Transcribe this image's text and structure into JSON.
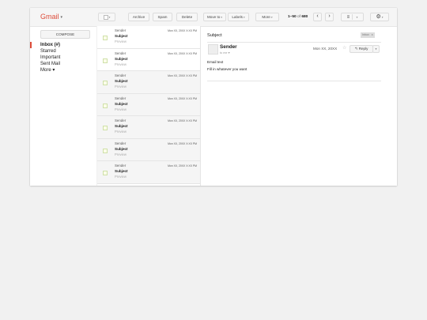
{
  "app": {
    "logo": "Gmail",
    "logo_caret": "▾"
  },
  "toolbar": {
    "select_caret": "▾",
    "archive": "Archive",
    "spam": "Spam",
    "delete": "Delete",
    "move_to": "Move to",
    "labels": "Labels",
    "more": "More",
    "caret": "▾",
    "pager_range": "1–50",
    "pager_of": " of ",
    "pager_total": "680",
    "prev": "‹",
    "next": "›",
    "density_icon": "≡",
    "gear_icon": "⚙"
  },
  "sidebar": {
    "compose": "COMPOSE",
    "items": [
      {
        "label": "Inbox (#)"
      },
      {
        "label": "Starred"
      },
      {
        "label": "Important"
      },
      {
        "label": "Sent Mail"
      },
      {
        "label": "More ▾"
      }
    ]
  },
  "messages": [
    {
      "sender": "Sender",
      "subject": "Subject",
      "preview": "Preview",
      "date": "Mon XX, 20XX X:XX PM"
    },
    {
      "sender": "Sender",
      "subject": "Subject",
      "preview": "Preview",
      "date": "Mon XX, 20XX X:XX PM"
    },
    {
      "sender": "Sender",
      "subject": "Subject",
      "preview": "Preview",
      "date": "Mon XX, 20XX X:XX PM"
    },
    {
      "sender": "Sender",
      "subject": "Subject",
      "preview": "Preview",
      "date": "Mon XX, 20XX X:XX PM"
    },
    {
      "sender": "Sender",
      "subject": "Subject",
      "preview": "Preview",
      "date": "Mon XX, 20XX X:XX PM"
    },
    {
      "sender": "Sender",
      "subject": "Subject",
      "preview": "Preview",
      "date": "Mon XX, 20XX X:XX PM"
    },
    {
      "sender": "Sender",
      "subject": "Subject",
      "preview": "Preview",
      "date": "Mon XX, 20XX X:XX PM"
    }
  ],
  "reading": {
    "subject": "Subject",
    "badge": "Inbox",
    "badge_close": "x",
    "sender": "Sender",
    "to": "to me",
    "to_caret": "▾",
    "date": "Mon XX, 20XX",
    "star": "☆",
    "reply": "Reply",
    "reply_icon": "↰",
    "more_caret": "▾",
    "body_line1": "Email text",
    "body_line2": "Fill in whatever you want"
  },
  "colors": {
    "brand": "#dd4b39",
    "toolbar_bg": "#f5f5f5",
    "border": "#dcdcdc"
  }
}
